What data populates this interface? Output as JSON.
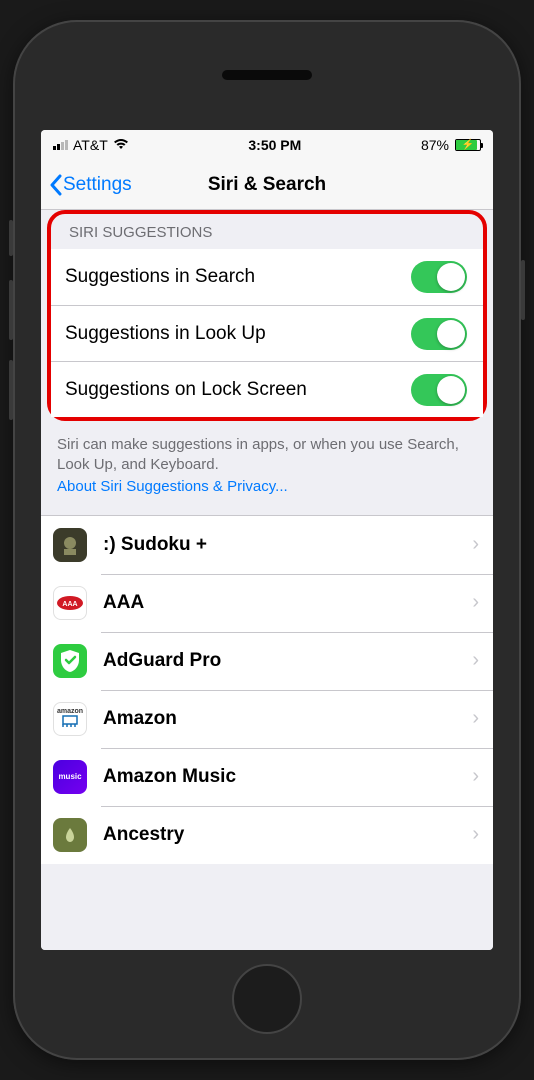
{
  "statusbar": {
    "carrier": "AT&T",
    "time": "3:50 PM",
    "battery_percent": "87%",
    "battery_fill_pct": 87
  },
  "nav": {
    "back_label": "Settings",
    "title": "Siri & Search"
  },
  "suggestions": {
    "header": "SIRI SUGGESTIONS",
    "items": [
      {
        "label": "Suggestions in Search",
        "on": true
      },
      {
        "label": "Suggestions in Look Up",
        "on": true
      },
      {
        "label": "Suggestions on Lock Screen",
        "on": true
      }
    ],
    "footer_text": "Siri can make suggestions in apps, or when you use Search, Look Up, and Keyboard.",
    "footer_link": "About Siri Suggestions & Privacy..."
  },
  "apps": [
    {
      "name": ":) Sudoku +",
      "icon_bg": "#3b3b2a",
      "icon_fg": "#d0d0b0",
      "icon_text": ""
    },
    {
      "name": "AAA",
      "icon_bg": "#ffffff",
      "icon_fg": "#d11924",
      "icon_text": "AAA"
    },
    {
      "name": "AdGuard Pro",
      "icon_bg": "#2ecc40",
      "icon_fg": "#ffffff",
      "icon_text": ""
    },
    {
      "name": "Amazon",
      "icon_bg": "#ffffff",
      "icon_fg": "#146eb4",
      "icon_text": ""
    },
    {
      "name": "Amazon Music",
      "icon_bg": "#4b00e0",
      "icon_fg": "#ffffff",
      "icon_text": "music"
    },
    {
      "name": "Ancestry",
      "icon_bg": "#6b7a3d",
      "icon_fg": "#d9e0b0",
      "icon_text": ""
    }
  ]
}
